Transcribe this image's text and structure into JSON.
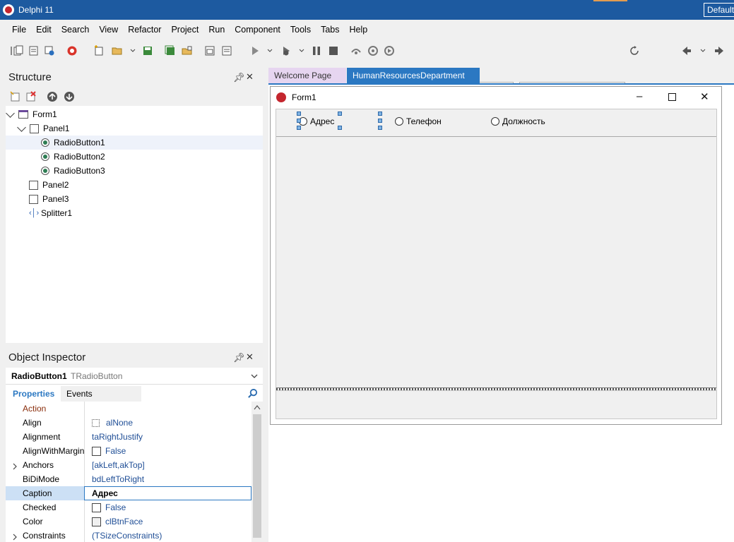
{
  "app": {
    "title": "Delphi 11",
    "layout_combo": "Default"
  },
  "menu": [
    "File",
    "Edit",
    "Search",
    "View",
    "Refactor",
    "Project",
    "Run",
    "Component",
    "Tools",
    "Tabs",
    "Help"
  ],
  "toolbar": {
    "combo1_value": "",
    "combo2_value": ""
  },
  "structure": {
    "title": "Structure",
    "items": [
      {
        "label": "Form1"
      },
      {
        "label": "Panel1"
      },
      {
        "label": "RadioButton1"
      },
      {
        "label": "RadioButton2"
      },
      {
        "label": "RadioButton3"
      },
      {
        "label": "Panel2"
      },
      {
        "label": "Panel3"
      },
      {
        "label": "Splitter1"
      }
    ]
  },
  "inspector": {
    "title": "Object Inspector",
    "object_name": "RadioButton1",
    "object_type": "TRadioButton",
    "tabs": [
      "Properties",
      "Events"
    ],
    "properties": [
      {
        "name": "Action",
        "value": ""
      },
      {
        "name": "Align",
        "value": "alNone"
      },
      {
        "name": "Alignment",
        "value": "taRightJustify"
      },
      {
        "name": "AlignWithMargins",
        "value": "False"
      },
      {
        "name": "Anchors",
        "value": "[akLeft,akTop]"
      },
      {
        "name": "BiDiMode",
        "value": "bdLeftToRight"
      },
      {
        "name": "Caption",
        "value": "Адрес"
      },
      {
        "name": "Checked",
        "value": "False"
      },
      {
        "name": "Color",
        "value": "clBtnFace"
      },
      {
        "name": "Constraints",
        "value": "(TSizeConstraints)"
      }
    ]
  },
  "editor": {
    "tabs": [
      "Welcome Page",
      "HumanResourcesDepartment"
    ]
  },
  "form": {
    "title": "Form1",
    "radios": [
      "Адрес",
      "Телефон",
      "Должность"
    ]
  },
  "colors": {
    "titlebar": "#1d5aa0",
    "active_tab": "#2b78c2",
    "inactive_tab": "#e6d5f0",
    "link_value": "#1f4e96"
  }
}
